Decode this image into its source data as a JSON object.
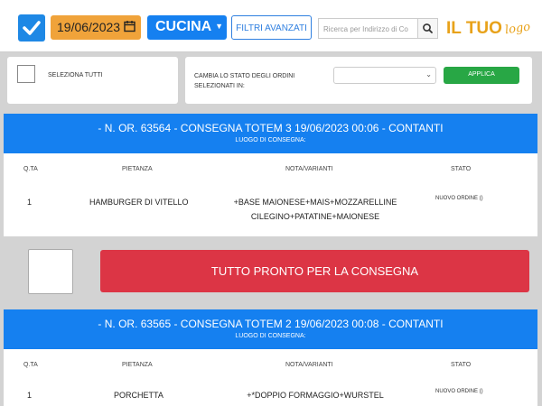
{
  "toolbar": {
    "date_value": "19/06/2023",
    "department": "CUCINA",
    "filters_label": "FILTRI AVANZATI",
    "search_placeholder": "Ricerca per Indirizzo di Co",
    "logo_main": "IL TUO",
    "logo_sub": "logo"
  },
  "bulk": {
    "select_all_label": "SELEZIONA TUTTI",
    "change_state_label": "CAMBIA LO STATO DEGLI ORDINI SELEZIONATI IN:",
    "state_selected": "",
    "apply_label": "APPLICA"
  },
  "columns": {
    "qty": "Q.TA",
    "dish": "PIETANZA",
    "notes": "NOTA/VARIANTI",
    "state": "STATO"
  },
  "orders": [
    {
      "title": "- N. OR. 63564 - CONSEGNA TOTEM 3 19/06/2023 00:06 - CONTANTI",
      "subtitle": "LUOGO DI CONSEGNA:",
      "items": [
        {
          "qty": "1",
          "dish": "HAMBURGER DI VITELLO",
          "notes_line1": "+BASE MAIONESE+MAIS+MOZZARELLINE",
          "notes_line2": "CILEGINO+PATATINE+MAIONESE",
          "state": "NUOVO ORDINE ()"
        }
      ],
      "ready_label": "TUTTO PRONTO PER LA CONSEGNA"
    },
    {
      "title": "- N. OR. 63565 - CONSEGNA TOTEM 2 19/06/2023 00:08 - CONTANTI",
      "subtitle": "LUOGO DI CONSEGNA:",
      "items": [
        {
          "qty": "1",
          "dish": "PORCHETTA",
          "notes_line1": "+*DOPPIO FORMAGGIO+WURSTEL",
          "notes_line2": "",
          "state": "NUOVO ORDINE ()"
        }
      ]
    }
  ],
  "colors": {
    "primary_blue": "#1580f0",
    "date_orange": "#f0a33a",
    "apply_green": "#28a745",
    "ready_red": "#dc3545",
    "logo_orange": "#e8a21a"
  },
  "icons": [
    "checkbox-checked-icon",
    "calendar-icon",
    "chevron-down-icon",
    "search-icon"
  ]
}
